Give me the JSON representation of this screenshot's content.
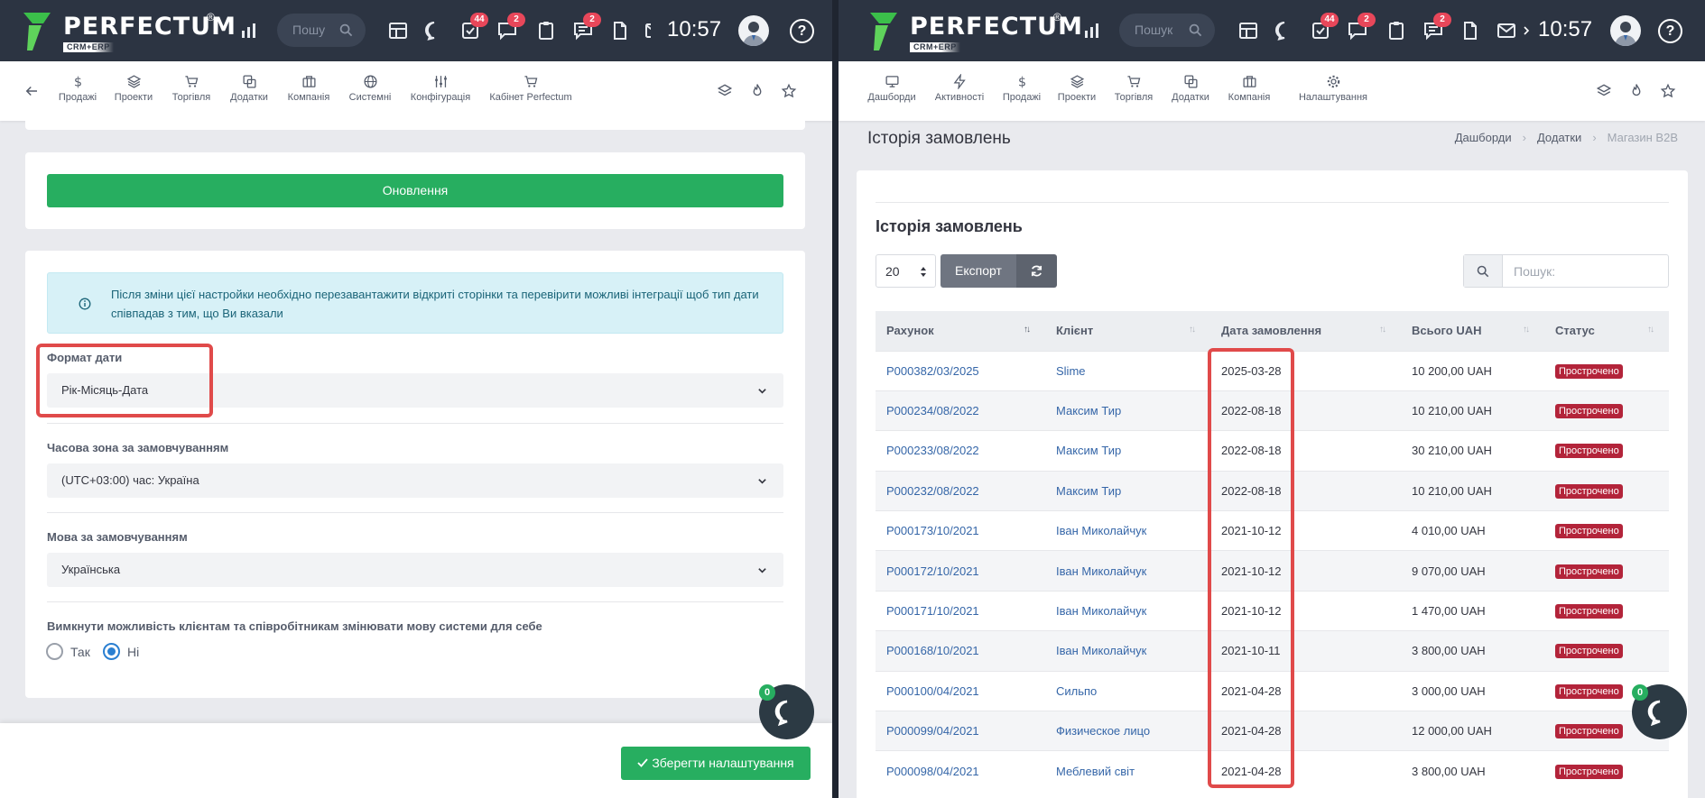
{
  "brand": {
    "name": "PERFECTUM",
    "registered": "®",
    "subtitle": "CRM+ERP"
  },
  "topbar": {
    "left": {
      "search_placeholder": "Пошу",
      "time": "10:57",
      "badges": {
        "tasks": "44",
        "comments": "2",
        "notes": "2"
      }
    },
    "right": {
      "search_placeholder": "Пошук",
      "time": "10:57",
      "badges": {
        "tasks": "44",
        "comments": "2",
        "notes": "2"
      }
    },
    "help": "?"
  },
  "left_nav": {
    "items": [
      {
        "label": "Продажі",
        "icon": "dollar-icon"
      },
      {
        "label": "Проекти",
        "icon": "layers-icon"
      },
      {
        "label": "Торгівля",
        "icon": "cart-icon"
      },
      {
        "label": "Додатки",
        "icon": "copy-icon"
      },
      {
        "label": "Компанія",
        "icon": "building-icon"
      },
      {
        "label": "Системні",
        "icon": "globe-icon"
      },
      {
        "label": "Конфігурація",
        "icon": "sliders-icon"
      },
      {
        "label": "Кабінет Perfectum",
        "icon": "cart-icon"
      }
    ]
  },
  "right_nav": {
    "items": [
      {
        "label": "Дашборди",
        "icon": "monitor-icon"
      },
      {
        "label": "Активності",
        "icon": "bolt-icon"
      },
      {
        "label": "Продажі",
        "icon": "dollar-icon"
      },
      {
        "label": "Проекти",
        "icon": "layers-icon"
      },
      {
        "label": "Торгівля",
        "icon": "cart-icon"
      },
      {
        "label": "Додатки",
        "icon": "copy-icon"
      },
      {
        "label": "Компанія",
        "icon": "building-icon"
      },
      {
        "label": "Налаштування",
        "icon": "gear-icon"
      }
    ]
  },
  "settings": {
    "update_button": "Оновлення",
    "alert_text": "Після зміни цієї настройки необхідно перезавантажити відкриті сторінки та перевірити можливі інтеграції щоб тип дати співпадав з тим, що Ви вказали",
    "date_format": {
      "label": "Формат дати",
      "value": "Рік-Місяць-Дата"
    },
    "timezone": {
      "label": "Часова зона за замовчуванням",
      "value": "(UTC+03:00) час: Україна"
    },
    "language": {
      "label": "Мова за замовчуванням",
      "value": "Українська"
    },
    "disable_lang_change": {
      "label": "Вимкнути можливість клієнтам та співробітникам змінювати мову системи для себе",
      "yes": "Так",
      "no": "Ні",
      "selected": "no"
    },
    "save_button": "Зберегти налаштування"
  },
  "chat": {
    "count": "0"
  },
  "orders": {
    "page_title": "Історія замовлень",
    "breadcrumb": [
      "Дашборди",
      "Додатки",
      "Магазин B2B"
    ],
    "table_title": "Історія замовлень",
    "page_size": "20",
    "export_button": "Експорт",
    "search_placeholder": "Пошук:",
    "columns": [
      "Рахунок",
      "Клієнт",
      "Дата замовлення",
      "Всього UAH",
      "Статус"
    ],
    "rows": [
      {
        "invoice": "P000382/03/2025",
        "client": "Slime",
        "date": "2025-03-28",
        "total": "10 200,00 UAH",
        "status": "Прострочено"
      },
      {
        "invoice": "P000234/08/2022",
        "client": "Максим Тир",
        "date": "2022-08-18",
        "total": "10 210,00 UAH",
        "status": "Прострочено"
      },
      {
        "invoice": "P000233/08/2022",
        "client": "Максим Тир",
        "date": "2022-08-18",
        "total": "30 210,00 UAH",
        "status": "Прострочено"
      },
      {
        "invoice": "P000232/08/2022",
        "client": "Максим Тир",
        "date": "2022-08-18",
        "total": "10 210,00 UAH",
        "status": "Прострочено"
      },
      {
        "invoice": "P000173/10/2021",
        "client": "Іван Миколайчук",
        "date": "2021-10-12",
        "total": "4 010,00 UAH",
        "status": "Прострочено"
      },
      {
        "invoice": "P000172/10/2021",
        "client": "Іван Миколайчук",
        "date": "2021-10-12",
        "total": "9 070,00 UAH",
        "status": "Прострочено"
      },
      {
        "invoice": "P000171/10/2021",
        "client": "Іван Миколайчук",
        "date": "2021-10-12",
        "total": "1 470,00 UAH",
        "status": "Прострочено"
      },
      {
        "invoice": "P000168/10/2021",
        "client": "Іван Миколайчук",
        "date": "2021-10-11",
        "total": "3 800,00 UAH",
        "status": "Прострочено"
      },
      {
        "invoice": "P000100/04/2021",
        "client": "Сильпо",
        "date": "2021-04-28",
        "total": "3 000,00 UAH",
        "status": "Прострочено"
      },
      {
        "invoice": "P000099/04/2021",
        "client": "Физическое лицо",
        "date": "2021-04-28",
        "total": "12 000,00 UAH",
        "status": "Прострочено"
      },
      {
        "invoice": "P000098/04/2021",
        "client": "Меблевий світ",
        "date": "2021-04-28",
        "total": "3 800,00 UAH",
        "status": "Прострочено"
      }
    ]
  },
  "colors": {
    "topbar": "#2c3442",
    "primary_green": "#27ae60",
    "status_red": "#b3243a",
    "link_blue": "#3566a8",
    "highlight_red": "#e04a4a"
  }
}
